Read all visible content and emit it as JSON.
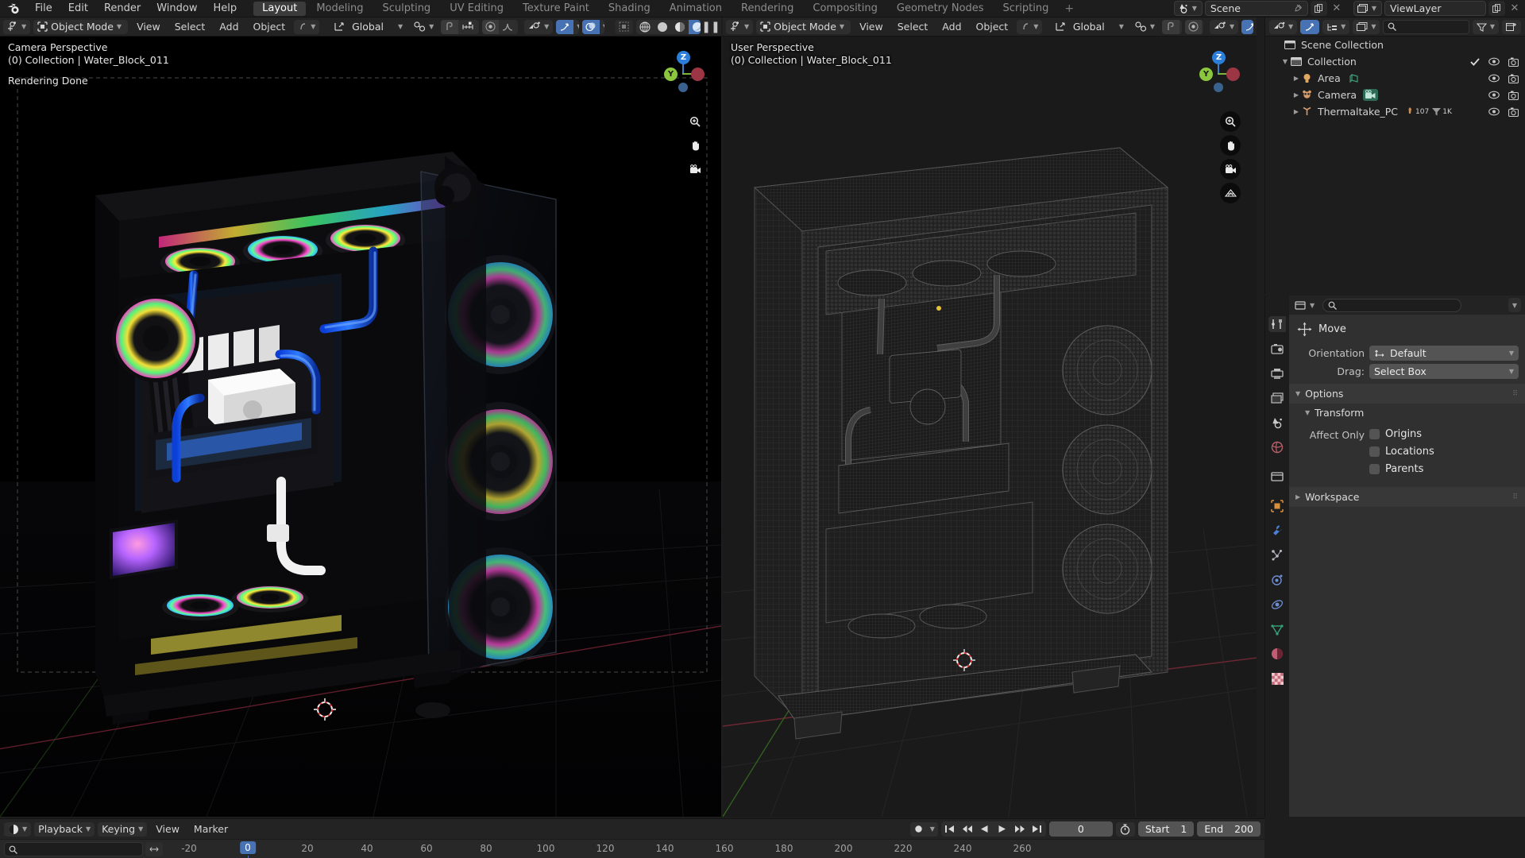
{
  "app": {
    "name": "Blender",
    "logo_icon": "blender-logo-icon"
  },
  "topbar": {
    "menus": [
      "File",
      "Edit",
      "Render",
      "Window",
      "Help"
    ],
    "workspace_tabs": [
      "Layout",
      "Modeling",
      "Sculpting",
      "UV Editing",
      "Texture Paint",
      "Shading",
      "Animation",
      "Rendering",
      "Compositing",
      "Geometry Nodes",
      "Scripting"
    ],
    "active_workspace": "Layout",
    "add_workspace_label": "+",
    "scene_icon": "scene-icon",
    "scene_name": "Scene",
    "pin_icon": "pin-icon",
    "copy_icon": "copy-icon",
    "close_icon": "close-icon",
    "viewlayer_icon": "viewlayer-icon",
    "viewlayer_name": "ViewLayer"
  },
  "viewport_left": {
    "mode": "Object Mode",
    "menus": [
      "View",
      "Select",
      "Add",
      "Object"
    ],
    "transform_orientation": "Global",
    "overlay_lines": [
      "Camera Perspective",
      "(0) Collection | Water_Block_011",
      "Rendering Done"
    ],
    "gizmo_axes": [
      {
        "label": "Z",
        "color": "#2b7fd8"
      },
      {
        "label": "Y",
        "color": "#8cc63f"
      },
      {
        "label": "X",
        "color": "#c0394b"
      }
    ],
    "tools": [
      "zoom-icon",
      "hand-icon",
      "camera-icon"
    ],
    "shading_modes": [
      "wireframe",
      "solid",
      "material",
      "rendered"
    ],
    "active_shading": "rendered"
  },
  "viewport_right": {
    "mode": "Object Mode",
    "menus": [
      "View",
      "Select",
      "Add",
      "Object"
    ],
    "transform_orientation": "Global",
    "overlay_lines": [
      "User Perspective",
      "(0) Collection | Water_Block_011"
    ],
    "gizmo_axes": [
      {
        "label": "Z",
        "color": "#2b7fd8"
      },
      {
        "label": "Y",
        "color": "#8cc63f"
      },
      {
        "label": "X",
        "color": "#c0394b"
      }
    ],
    "tools": [
      "zoom-icon",
      "hand-icon",
      "camera-icon",
      "grid-icon"
    ]
  },
  "outliner": {
    "display_mode_icon": "view-layer-icon",
    "filter_icon": "filter-icon",
    "new_collection_icon": "new-collection-icon",
    "search_placeholder": "",
    "rows": [
      {
        "label": "Scene Collection",
        "icon": "collection-icon",
        "depth": 0,
        "expander": "",
        "checkbox": false,
        "eye": false,
        "camera": false
      },
      {
        "label": "Collection",
        "icon": "collection-icon",
        "depth": 1,
        "expander": "down",
        "checkbox": true,
        "eye": true,
        "camera": true
      },
      {
        "label": "Area",
        "icon": "light-icon",
        "depth": 2,
        "expander": "right",
        "badge": "light-data-icon",
        "eye": true,
        "camera": true
      },
      {
        "label": "Camera",
        "icon": "camera-object-icon",
        "depth": 2,
        "expander": "right",
        "badge": "camera-data-icon",
        "eye": true,
        "camera": true
      },
      {
        "label": "Thermaltake_PC",
        "icon": "empty-axes-icon",
        "depth": 2,
        "expander": "right",
        "badge": "modifier-icons",
        "badge_text_1": "107",
        "badge_text_2": "1K",
        "eye": true,
        "camera": true
      }
    ]
  },
  "properties": {
    "search_placeholder": "",
    "tabs": [
      "tool-icon",
      "render-icon",
      "output-icon",
      "view-layer-icon",
      "scene-icon",
      "world-icon",
      "collection-props-icon",
      "object-icon",
      "modifier-icon",
      "particles-icon",
      "physics-icon",
      "constraints-icon",
      "data-icon",
      "material-icon",
      "texture-icon"
    ],
    "active_tab": "tool-icon",
    "tool_title": "Move",
    "tool_icon": "move-icon",
    "fields": [
      {
        "label": "Orientation",
        "value": "Default",
        "icon": "orientation-icon"
      },
      {
        "label": "Drag:",
        "value": "Select Box",
        "icon": ""
      }
    ],
    "panels": [
      {
        "label": "Options",
        "expanded": true
      },
      {
        "label": "Transform",
        "expanded": true,
        "sub": true
      },
      {
        "label": "Workspace",
        "expanded": false
      }
    ],
    "affect_only_label": "Affect Only",
    "checkboxes": [
      {
        "label": "Origins",
        "checked": false
      },
      {
        "label": "Locations",
        "checked": false
      },
      {
        "label": "Parents",
        "checked": false
      }
    ]
  },
  "timeline": {
    "editor_icon": "timeline-icon",
    "menus": [
      "Playback",
      "Keying",
      "View",
      "Marker"
    ],
    "dropdown_menus": [
      "Playback",
      "Keying"
    ],
    "plain_menus": [
      "View",
      "Marker"
    ],
    "search_placeholder": "",
    "auto_key_icon": "record-icon",
    "transport_buttons": [
      "jump-start",
      "prev-keyframe",
      "play-reverse",
      "play",
      "next-keyframe",
      "jump-end"
    ],
    "current_frame": "0",
    "frame_field_value": "0",
    "start_label": "Start",
    "start_value": "1",
    "end_label": "End",
    "end_value": "200",
    "ruler_ticks": [
      "-20",
      "0",
      "20",
      "40",
      "60",
      "80",
      "100",
      "120",
      "140",
      "160",
      "180",
      "200",
      "220",
      "240",
      "260"
    ],
    "stopwatch_icon": "stopwatch-icon"
  },
  "colors": {
    "accent_blue": "#4772b3",
    "panel_bg": "#303030",
    "header_bg": "#232323",
    "window_bg": "#1d1d1d",
    "axis_x": "#c0394b",
    "axis_y": "#8cc63f",
    "axis_z": "#2b7fd8"
  }
}
